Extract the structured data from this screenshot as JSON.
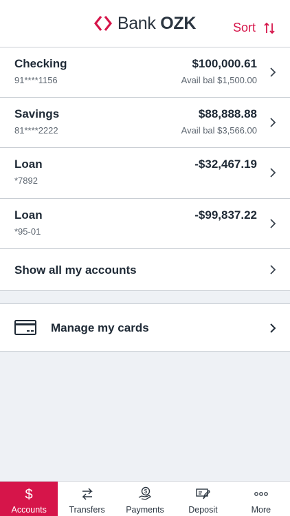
{
  "header": {
    "brand_prefix": "Bank",
    "brand_name": "OZK",
    "sort_label": "Sort",
    "accent_color": "#d6154a"
  },
  "accounts": [
    {
      "name": "Checking",
      "number": "91****1156",
      "balance": "$100,000.61",
      "available": "Avail bal $1,500.00"
    },
    {
      "name": "Savings",
      "number": "81****2222",
      "balance": "$88,888.88",
      "available": "Avail bal $3,566.00"
    },
    {
      "name": "Loan",
      "number": "*7892",
      "balance": "-$32,467.19",
      "available": ""
    },
    {
      "name": "Loan",
      "number": "*95-01",
      "balance": "-$99,837.22",
      "available": ""
    }
  ],
  "show_all_label": "Show all my accounts",
  "manage_cards_label": "Manage my cards",
  "tabs": [
    {
      "label": "Accounts",
      "icon": "dollar-icon",
      "active": true
    },
    {
      "label": "Transfers",
      "icon": "transfer-arrows-icon",
      "active": false
    },
    {
      "label": "Payments",
      "icon": "hand-coin-icon",
      "active": false
    },
    {
      "label": "Deposit",
      "icon": "check-deposit-icon",
      "active": false
    },
    {
      "label": "More",
      "icon": "more-dots-icon",
      "active": false
    }
  ]
}
